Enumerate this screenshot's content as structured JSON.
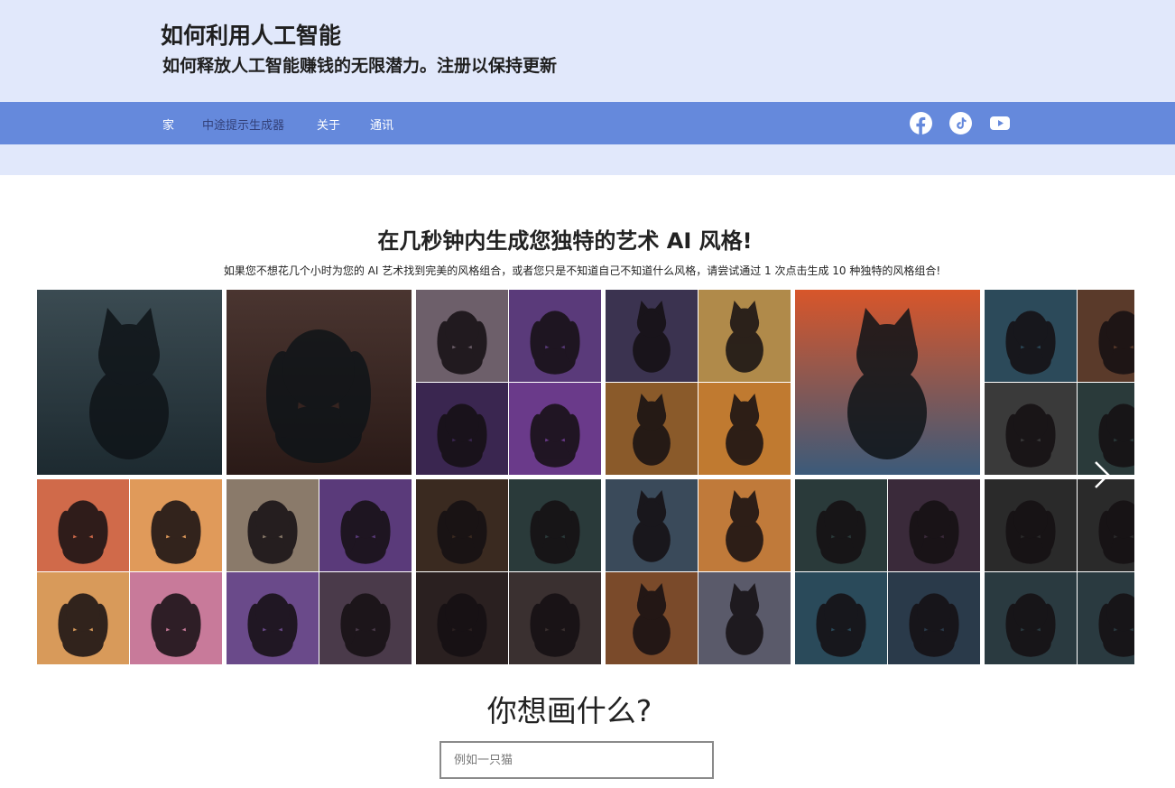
{
  "header": {
    "site_title": "如何利用人工智能",
    "tagline": "如何释放人工智能赚钱的无限潜力。注册以保持更新"
  },
  "nav": {
    "items": [
      {
        "label": "家",
        "current": false
      },
      {
        "label": "中途提示生成器",
        "current": true
      },
      {
        "label": "关于",
        "current": false
      },
      {
        "label": "通讯",
        "current": false
      }
    ],
    "social": [
      "facebook-icon",
      "tiktok-icon",
      "youtube-icon"
    ]
  },
  "hero": {
    "title": "在几秒钟内生成您独特的艺术 AI 风格!",
    "subtitle": "如果您不想花几个小时为您的 AI 艺术找到完美的风格组合，或者您只是不知道自己不知道什么风格，请尝试通过 1 次点击生成 10 种独特的风格组合!"
  },
  "gallery": {
    "next_icon": "chevron-right-icon",
    "rows": [
      [
        {
          "layout": "single",
          "colors": [
            "#3b4b52",
            "#1d2a30"
          ],
          "subject": "cat"
        },
        {
          "layout": "single",
          "colors": [
            "#4a3530",
            "#2a1a17"
          ],
          "subject": "dog"
        },
        {
          "layout": "grid",
          "colors": [
            "#6d5f6a",
            "#5a3a7a",
            "#3a2650",
            "#6a3a8a"
          ],
          "subject": "dog"
        },
        {
          "layout": "grid",
          "colors": [
            "#3b3350",
            "#b08a4a",
            "#8a5a2a",
            "#c07a30"
          ],
          "subject": "cat"
        },
        {
          "layout": "single",
          "colors": [
            "#d8562a",
            "#3b5a7a"
          ],
          "subject": "cat"
        },
        {
          "layout": "grid",
          "colors": [
            "#2c4a5a",
            "#5a3a2a",
            "#3a3a3a",
            "#2a3a3a"
          ],
          "subject": "dog"
        }
      ],
      [
        {
          "layout": "grid",
          "colors": [
            "#d06a4a",
            "#e09a5a",
            "#d89a5a",
            "#c87a9a"
          ],
          "subject": "dog"
        },
        {
          "layout": "grid",
          "colors": [
            "#8a7a6a",
            "#5a3a7a",
            "#6a4a8a",
            "#4a3a4a"
          ],
          "subject": "dog"
        },
        {
          "layout": "grid",
          "colors": [
            "#3a2a20",
            "#2a3a3a",
            "#2a2020",
            "#3a3030"
          ],
          "subject": "dog"
        },
        {
          "layout": "grid",
          "colors": [
            "#3a4a5a",
            "#c07a3a",
            "#7a4a2a",
            "#5a5a6a"
          ],
          "subject": "cat"
        },
        {
          "layout": "grid",
          "colors": [
            "#2a3a3a",
            "#3a2a3a",
            "#2a4a5a",
            "#2a3a4a"
          ],
          "subject": "dog"
        },
        {
          "layout": "grid",
          "colors": [
            "#2a2a2a",
            "#2a2a2a",
            "#2a3a40",
            "#2a3a40"
          ],
          "subject": "dog"
        }
      ]
    ]
  },
  "prompt": {
    "question": "你想画什么?",
    "placeholder": "例如一只猫"
  }
}
